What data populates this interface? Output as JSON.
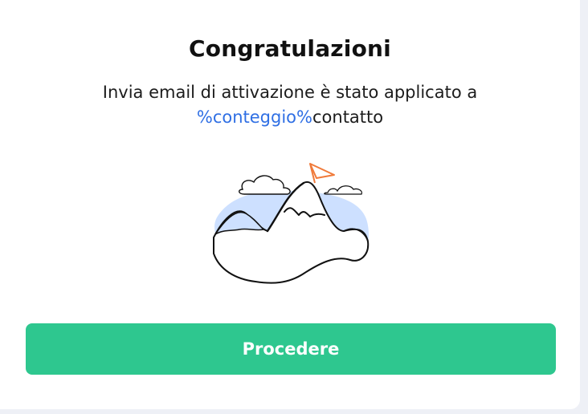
{
  "dialog": {
    "title": "Congratulazioni",
    "message_prefix": "Invia email di attivazione è stato applicato a",
    "count_placeholder": "%conteggio%",
    "message_suffix": "contatto",
    "proceed_label": "Procedere"
  },
  "colors": {
    "accent_button": "#2ec78f",
    "placeholder_text": "#2f6fe4",
    "illustration_fill": "#cde0ff",
    "flag": "#f07a3a"
  },
  "icons": {
    "illustration": "mountain-summit-flag-illustration"
  }
}
